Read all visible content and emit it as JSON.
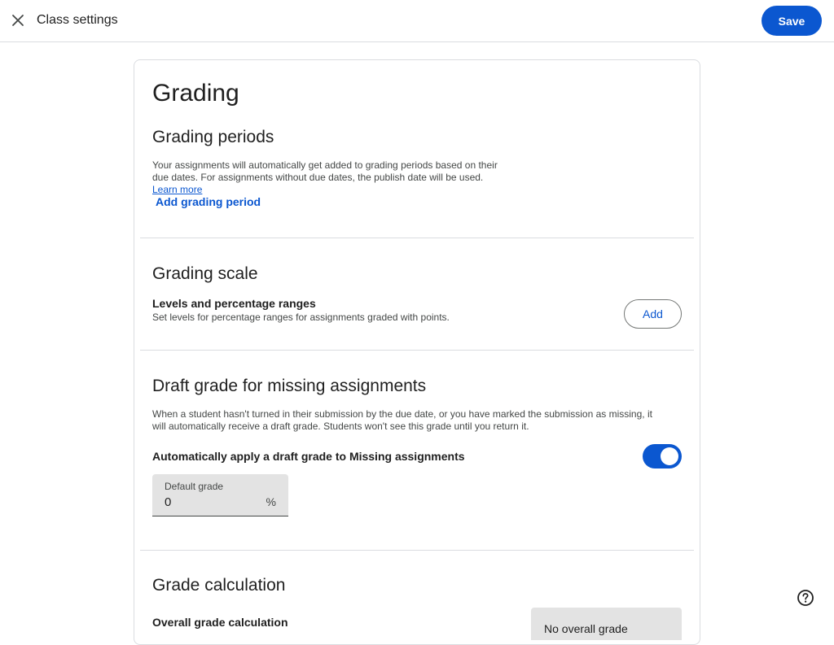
{
  "header": {
    "title": "Class settings",
    "save_label": "Save"
  },
  "main": {
    "title": "Grading",
    "grading_periods": {
      "heading": "Grading periods",
      "description": "Your assignments will automatically get added to grading periods based on their due dates. For assignments without due dates, the publish date will be used.",
      "learn_more": "Learn more",
      "add_label": "Add grading period"
    },
    "grading_scale": {
      "heading": "Grading scale",
      "subheading": "Levels and percentage ranges",
      "description": "Set levels for percentage ranges for assignments graded with points.",
      "add_label": "Add"
    },
    "draft_grade": {
      "heading": "Draft grade for missing assignments",
      "description": "When a student hasn't turned in their submission by the due date, or you have marked the submission as missing, it will automatically receive a draft grade. Students won't see this grade until you return it.",
      "toggle_label": "Automatically apply a draft grade to Missing assignments",
      "toggle_on": true,
      "field_label": "Default grade",
      "field_value": "0",
      "field_suffix": "%"
    },
    "grade_calculation": {
      "heading": "Grade calculation",
      "subheading": "Overall grade calculation",
      "select_value": "No overall grade"
    }
  },
  "icons": {
    "close": "close-icon",
    "help": "help-circle-icon"
  },
  "colors": {
    "accent": "#0b57d0",
    "field_bg": "#e3e3e3",
    "divider": "#dadce0"
  }
}
